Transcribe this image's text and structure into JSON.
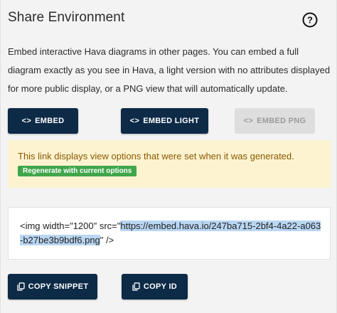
{
  "header": {
    "title": "Share Environment"
  },
  "description": "Embed interactive Hava diagrams in other pages. You can embed a full diagram exactly as you see in Hava, a light version with no attributes displayed for more public display, or a PNG view that will automatically update.",
  "embed_buttons": {
    "embed": {
      "icon_text": "<>",
      "label": "EMBED"
    },
    "embed_light": {
      "icon_text": "<>",
      "label": "EMBED LIGHT"
    },
    "embed_png": {
      "icon_text": "<>",
      "label": "EMBED PNG",
      "disabled": true
    }
  },
  "notice": {
    "text": "This link displays view options that were set when it was generated.",
    "regenerate_label": "Regenerate with current options"
  },
  "snippet": {
    "prefix": "<img width=\"1200\" src=\"",
    "url": "https://embed.hava.io/247ba715-2bf4-4a22-a063-b27be3b9bdf6.png",
    "suffix": "\" />"
  },
  "copy_buttons": {
    "copy_snippet": {
      "icon": "copy-icon",
      "label": "COPY SNIPPET"
    },
    "copy_id": {
      "icon": "copy-icon",
      "label": "COPY ID"
    }
  },
  "colors": {
    "primary_button": "#0d2a47",
    "disabled_button": "#dedede",
    "notice_background": "#fdf3d1",
    "notice_text": "#8a5a00",
    "regenerate_button": "#3fa64a",
    "selection": "#b9d6f3"
  }
}
